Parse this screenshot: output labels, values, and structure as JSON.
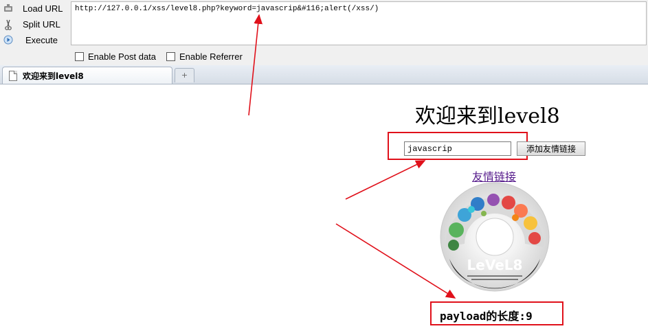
{
  "hackbar": {
    "load_url": "Load URL",
    "split_url": "Split URL",
    "execute": "Execute",
    "url_value": "http://127.0.0.1/xss/level8.php?keyword=javascrip&#116;alert(/xss/)",
    "enable_post": "Enable Post data",
    "enable_referrer": "Enable Referrer"
  },
  "browser": {
    "tab_title": "欢迎来到level8",
    "new_tab": "+"
  },
  "page": {
    "heading": "欢迎来到level8",
    "keyword_value": "javascrip",
    "submit_label": "添加友情链接",
    "friend_link": "友情链接",
    "disc_text": "LeVeL8"
  },
  "annotation": {
    "payload_length": "payload的长度:9",
    "color": "#e0101a"
  }
}
